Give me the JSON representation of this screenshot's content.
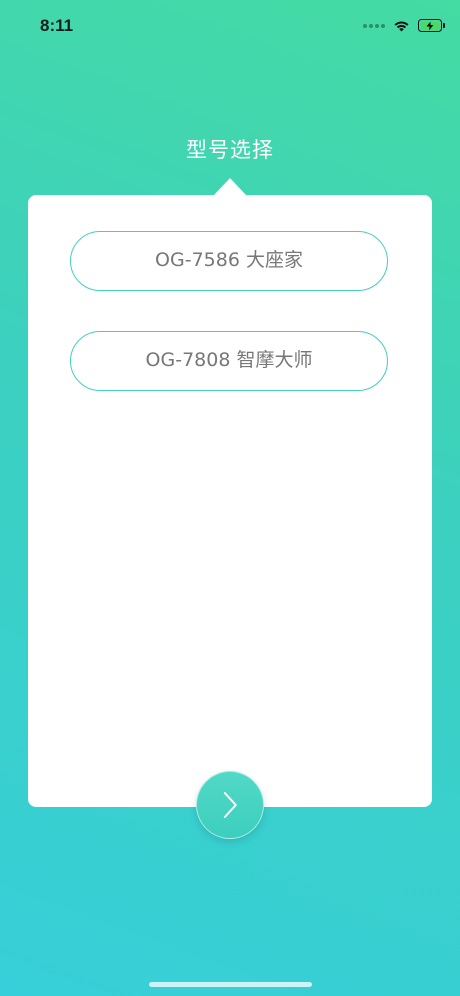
{
  "status_bar": {
    "time": "8:11"
  },
  "page": {
    "title": "型号选择"
  },
  "models": [
    {
      "label": "OG-7586 大座家"
    },
    {
      "label": "OG-7808 智摩大师"
    }
  ],
  "icons": {
    "next": "chevron-right-icon",
    "wifi": "wifi-icon",
    "battery": "battery-charging-icon"
  },
  "colors": {
    "accent": "#45cfc0",
    "gradient_top": "#45dba3",
    "gradient_bottom": "#37cfd9",
    "option_text": "#777777"
  }
}
